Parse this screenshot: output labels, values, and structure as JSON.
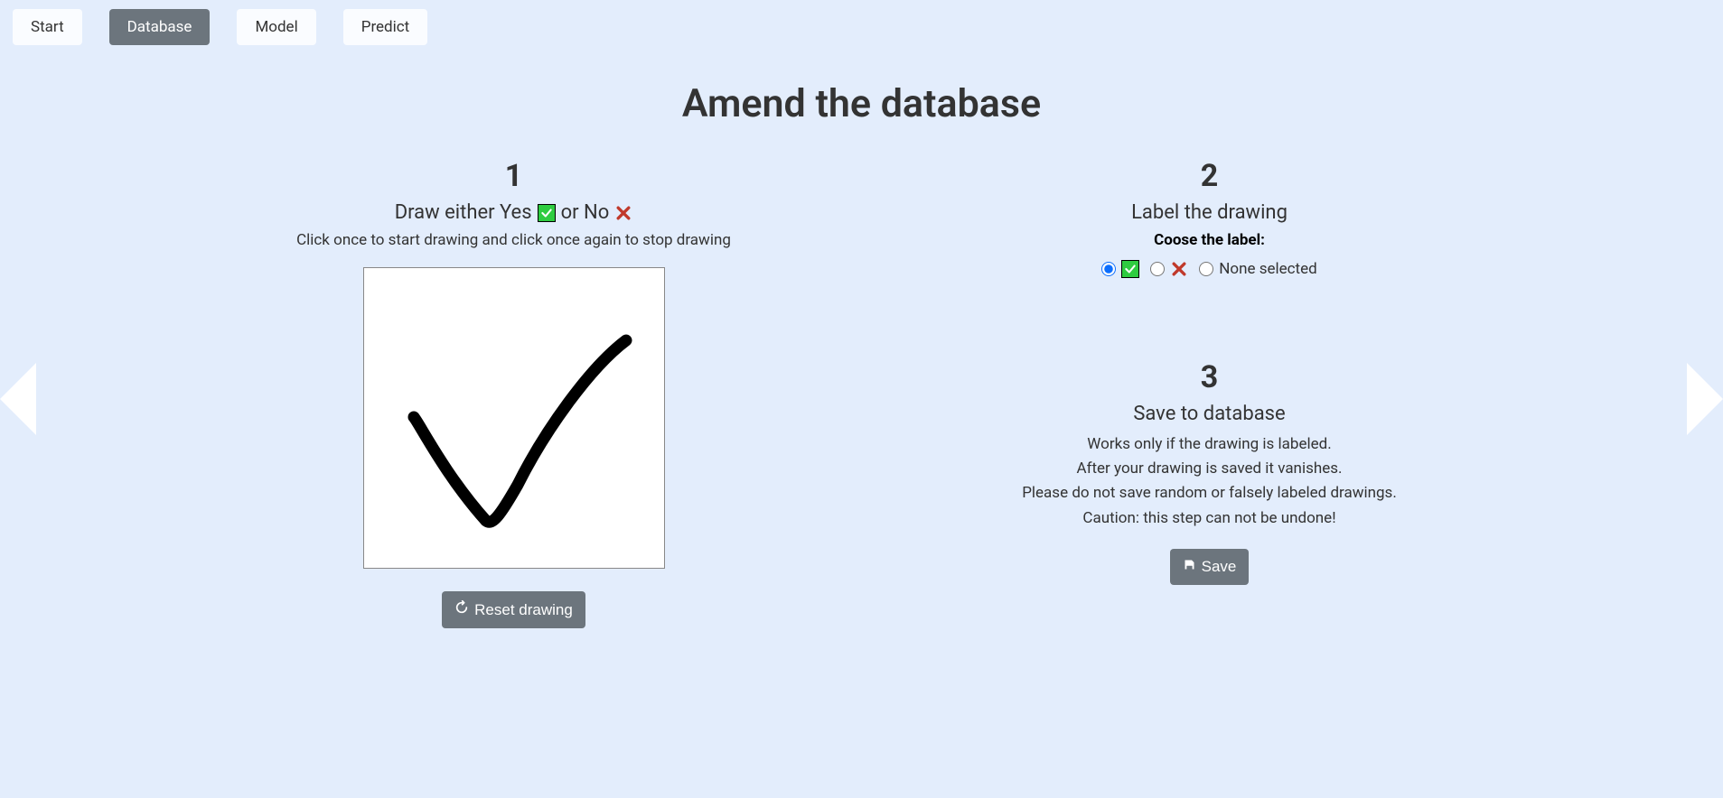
{
  "nav": {
    "items": [
      {
        "label": "Start",
        "active": false
      },
      {
        "label": "Database",
        "active": true
      },
      {
        "label": "Model",
        "active": false
      },
      {
        "label": "Predict",
        "active": false
      }
    ]
  },
  "page_title": "Amend the database",
  "step1": {
    "num": "1",
    "title_pre": "Draw either Yes",
    "title_mid": "or No",
    "sub": "Click once to start drawing and click once again to stop drawing",
    "reset_label": "Reset drawing"
  },
  "step2": {
    "num": "2",
    "title": "Label the drawing",
    "choose_label": "Coose the label:",
    "option_none": "None selected"
  },
  "step3": {
    "num": "3",
    "title": "Save to database",
    "line1": "Works only if the drawing is labeled.",
    "line2": "After your drawing is saved it vanishes.",
    "line3": "Please do not save random or falsely labeled drawings.",
    "line4": "Caution: this step can not be undone!",
    "save_label": "Save"
  }
}
